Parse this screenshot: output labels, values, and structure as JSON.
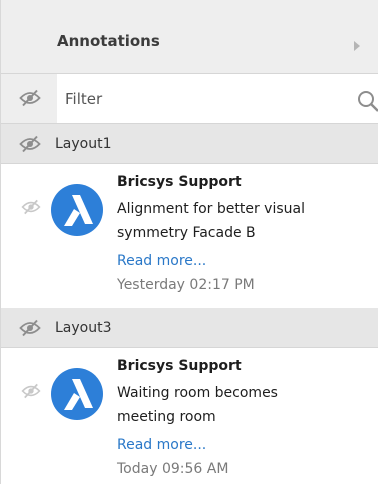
{
  "header": {
    "title": "Annotations"
  },
  "filter": {
    "placeholder": "Filter"
  },
  "groups": [
    {
      "label": "Layout1",
      "items": [
        {
          "author": "Bricsys Support",
          "message_line1": "Alignment for better visual",
          "message_line2": "symmetry Facade B",
          "link": "Read more...",
          "time": "Yesterday 02:17 PM"
        }
      ]
    },
    {
      "label": "Layout3",
      "items": [
        {
          "author": "Bricsys Support",
          "message_line1": "Waiting room becomes",
          "message_line2": "meeting room",
          "link": "Read more...",
          "time": "Today 09:56 AM"
        }
      ]
    }
  ],
  "icons": {
    "visibility": "eye-slash-icon",
    "search": "search-icon",
    "expand": "chevron-right-icon",
    "avatar": "bricsys-logo-icon"
  },
  "colors": {
    "avatar_bg": "#2d7fd8",
    "link": "#2a78c8"
  }
}
